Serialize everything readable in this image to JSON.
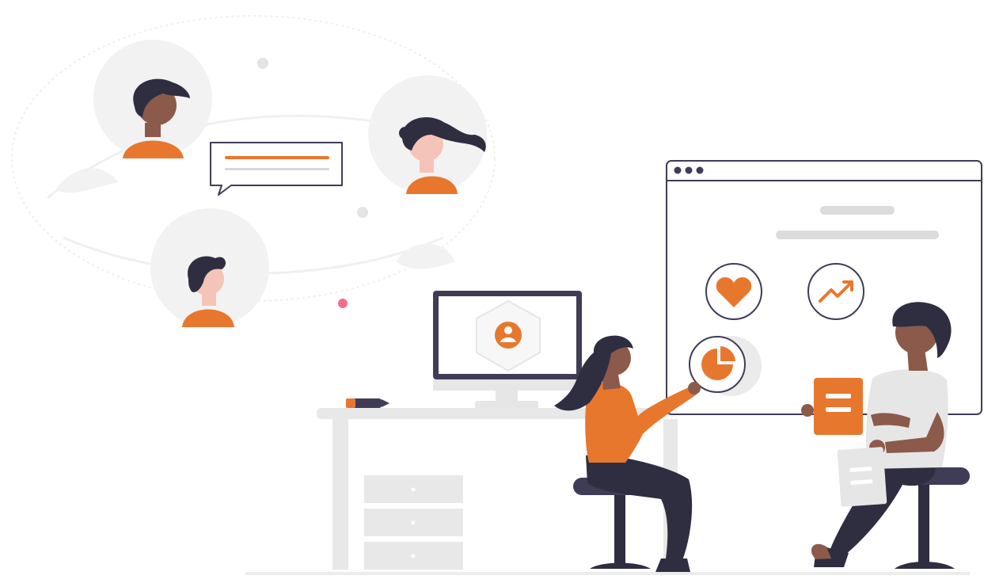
{
  "scene": {
    "colors": {
      "accent": "#e8772e",
      "dark": "#2f2e41",
      "light_gray": "#ebebeb",
      "mid_gray": "#cfcfcf",
      "outline": "#3f3d56",
      "skin_dark": "#8b5a4a",
      "skin_light": "#f5c4b8",
      "pink_dot": "#f26d8a",
      "white": "#ffffff"
    },
    "icons": [
      "avatar-man-icon",
      "avatar-woman-icon",
      "avatar-boy-icon",
      "chat-bubble-icon",
      "heart-icon",
      "trend-up-icon",
      "pie-chart-icon",
      "user-profile-icon",
      "document-icon"
    ]
  }
}
